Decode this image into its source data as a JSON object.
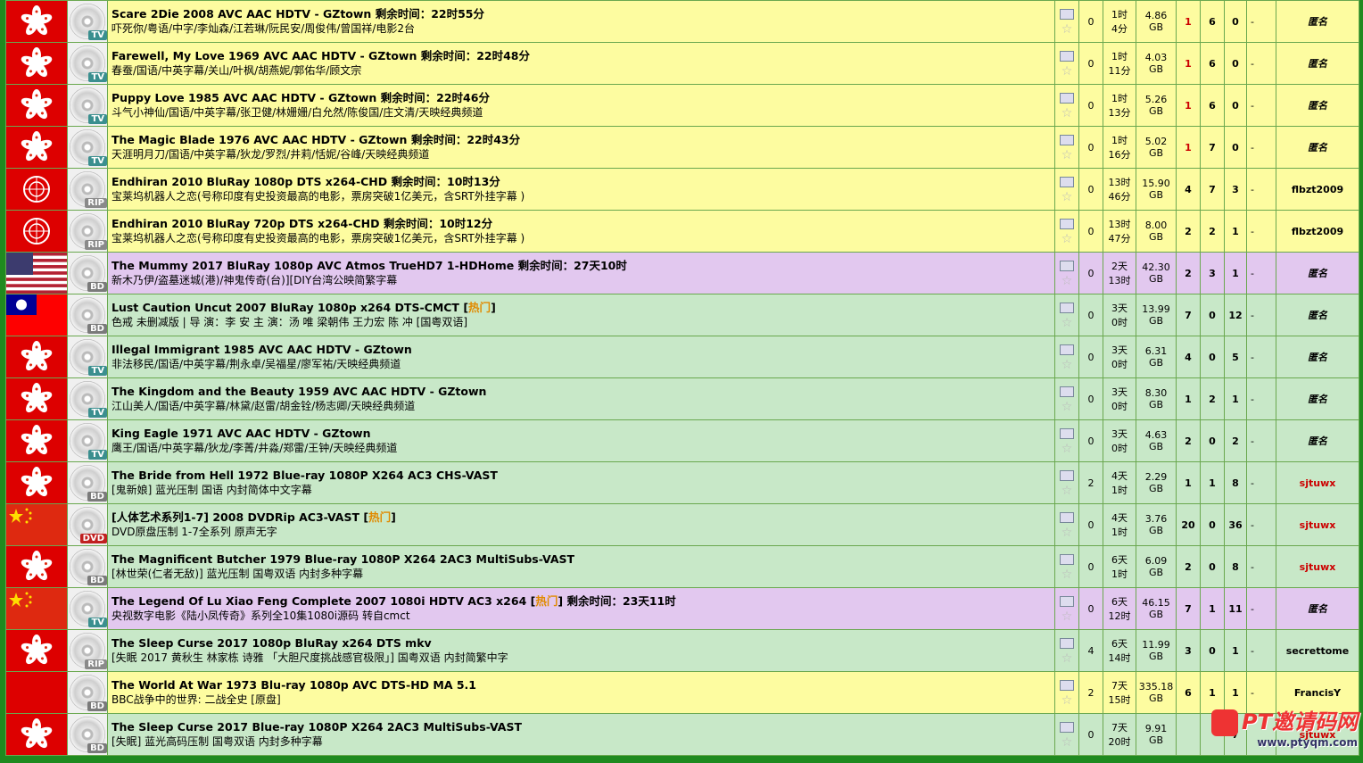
{
  "rows": [
    {
      "bg": "yellow",
      "flag": "hk",
      "cat": "TV",
      "title": "Scare 2Die 2008 AVC AAC HDTV - GZtown",
      "remain": "剩余时间：22时55分",
      "hot": "",
      "sub": "吓死你/粤语/中字/李灿森/江若琳/阮民安/周俊伟/曾国祥/电影2台",
      "comments": "0",
      "time1": "1时",
      "time2": "4分",
      "size1": "4.86",
      "size2": "GB",
      "seeders": "1",
      "seeders_red": true,
      "leechers": "6",
      "snatched": "0",
      "progress": "-",
      "uploader": "匿名",
      "uploader_style": "anon"
    },
    {
      "bg": "yellow",
      "flag": "hk",
      "cat": "TV",
      "title": "Farewell, My Love 1969 AVC AAC HDTV - GZtown",
      "remain": "剩余时间：22时48分",
      "hot": "",
      "sub": "春蚕/国语/中英字幕/关山/叶枫/胡燕妮/郭佑华/顾文宗",
      "comments": "0",
      "time1": "1时",
      "time2": "11分",
      "size1": "4.03",
      "size2": "GB",
      "seeders": "1",
      "seeders_red": true,
      "leechers": "6",
      "snatched": "0",
      "progress": "-",
      "uploader": "匿名",
      "uploader_style": "anon"
    },
    {
      "bg": "yellow",
      "flag": "hk",
      "cat": "TV",
      "title": "Puppy Love 1985 AVC AAC HDTV - GZtown",
      "remain": "剩余时间：22时46分",
      "hot": "",
      "sub": "斗气小神仙/国语/中英字幕/张卫健/林姗姗/白允然/陈俊国/庄文清/天映经典频道",
      "comments": "0",
      "time1": "1时",
      "time2": "13分",
      "size1": "5.26",
      "size2": "GB",
      "seeders": "1",
      "seeders_red": true,
      "leechers": "6",
      "snatched": "0",
      "progress": "-",
      "uploader": "匿名",
      "uploader_style": "anon"
    },
    {
      "bg": "yellow",
      "flag": "hk",
      "cat": "TV",
      "title": "The Magic Blade 1976 AVC AAC HDTV - GZtown",
      "remain": "剩余时间：22时43分",
      "hot": "",
      "sub": "天涯明月刀/国语/中英字幕/狄龙/罗烈/井莉/恬妮/谷峰/天映经典频道",
      "comments": "0",
      "time1": "1时",
      "time2": "16分",
      "size1": "5.02",
      "size2": "GB",
      "seeders": "1",
      "seeders_red": true,
      "leechers": "7",
      "snatched": "0",
      "progress": "-",
      "uploader": "匿名",
      "uploader_style": "anon"
    },
    {
      "bg": "yellow",
      "flag": "un",
      "cat": "RIP",
      "title": "Endhiran 2010 BluRay 1080p DTS x264-CHD",
      "remain": "剩余时间：10时13分",
      "hot": "",
      "sub": "宝莱坞机器人之恋(号称印度有史投资最高的电影，票房突破1亿美元，含SRT外挂字幕 )",
      "comments": "0",
      "time1": "13时",
      "time2": "46分",
      "size1": "15.90",
      "size2": "GB",
      "seeders": "4",
      "seeders_red": false,
      "leechers": "7",
      "snatched": "3",
      "progress": "-",
      "uploader": "flbzt2009",
      "uploader_style": "bold"
    },
    {
      "bg": "yellow",
      "flag": "un",
      "cat": "RIP",
      "title": "Endhiran 2010 BluRay 720p DTS x264-CHD",
      "remain": "剩余时间：10时12分",
      "hot": "",
      "sub": "宝莱坞机器人之恋(号称印度有史投资最高的电影，票房突破1亿美元，含SRT外挂字幕 )",
      "comments": "0",
      "time1": "13时",
      "time2": "47分",
      "size1": "8.00",
      "size2": "GB",
      "seeders": "2",
      "seeders_red": false,
      "leechers": "2",
      "snatched": "1",
      "progress": "-",
      "uploader": "flbzt2009",
      "uploader_style": "bold"
    },
    {
      "bg": "purple",
      "flag": "us",
      "cat": "BD",
      "title": "The Mummy 2017 BluRay 1080p AVC Atmos TrueHD7 1-HDHome",
      "remain": "剩余时间：27天10时",
      "hot": "",
      "sub": "新木乃伊/盗墓迷城(港)/神鬼传奇(台)][DIY台湾公映简繁字幕",
      "comments": "0",
      "time1": "2天",
      "time2": "13时",
      "size1": "42.30",
      "size2": "GB",
      "seeders": "2",
      "seeders_red": false,
      "leechers": "3",
      "snatched": "1",
      "progress": "-",
      "uploader": "匿名",
      "uploader_style": "anon"
    },
    {
      "bg": "green",
      "flag": "tw",
      "cat": "BD",
      "title": "Lust Caution Uncut 2007 BluRay 1080p x264 DTS-CMCT",
      "remain": "",
      "hot": "热门",
      "sub": "色戒 未删减版 | 导 演：李 安 主 演：汤 唯 梁朝伟 王力宏 陈 冲 [国粤双语]",
      "comments": "0",
      "time1": "3天",
      "time2": "0时",
      "size1": "13.99",
      "size2": "GB",
      "seeders": "7",
      "seeders_red": false,
      "leechers": "0",
      "snatched": "12",
      "progress": "-",
      "uploader": "匿名",
      "uploader_style": "anon"
    },
    {
      "bg": "green",
      "flag": "hk",
      "cat": "TV",
      "title": "Illegal Immigrant 1985 AVC AAC HDTV - GZtown",
      "remain": "",
      "hot": "",
      "sub": "非法移民/国语/中英字幕/荆永卓/吴福星/廖军祐/天映经典频道",
      "comments": "0",
      "time1": "3天",
      "time2": "0时",
      "size1": "6.31",
      "size2": "GB",
      "seeders": "4",
      "seeders_red": false,
      "leechers": "0",
      "snatched": "5",
      "progress": "-",
      "uploader": "匿名",
      "uploader_style": "anon"
    },
    {
      "bg": "green",
      "flag": "hk",
      "cat": "TV",
      "title": "The Kingdom and the Beauty 1959 AVC AAC HDTV - GZtown",
      "remain": "",
      "hot": "",
      "sub": "江山美人/国语/中英字幕/林黛/赵雷/胡金铨/杨志卿/天映经典频道",
      "comments": "0",
      "time1": "3天",
      "time2": "0时",
      "size1": "8.30",
      "size2": "GB",
      "seeders": "1",
      "seeders_red": false,
      "leechers": "2",
      "snatched": "1",
      "progress": "-",
      "uploader": "匿名",
      "uploader_style": "anon"
    },
    {
      "bg": "green",
      "flag": "hk",
      "cat": "TV",
      "title": "King Eagle 1971 AVC AAC HDTV - GZtown",
      "remain": "",
      "hot": "",
      "sub": "鹰王/国语/中英字幕/狄龙/李菁/井淼/郑雷/王钟/天映经典频道",
      "comments": "0",
      "time1": "3天",
      "time2": "0时",
      "size1": "4.63",
      "size2": "GB",
      "seeders": "2",
      "seeders_red": false,
      "leechers": "0",
      "snatched": "2",
      "progress": "-",
      "uploader": "匿名",
      "uploader_style": "anon"
    },
    {
      "bg": "green",
      "flag": "hk",
      "cat": "BD",
      "title": "The Bride from Hell 1972 Blue-ray 1080P X264 AC3 CHS-VAST",
      "remain": "",
      "hot": "",
      "sub": "[鬼新娘] 蓝光压制 国语 内封简体中文字幕",
      "comments": "2",
      "time1": "4天",
      "time2": "1时",
      "size1": "2.29",
      "size2": "GB",
      "seeders": "1",
      "seeders_red": false,
      "leechers": "1",
      "snatched": "8",
      "progress": "-",
      "uploader": "sjtuwx",
      "uploader_style": "red"
    },
    {
      "bg": "green",
      "flag": "cn",
      "cat": "DVD",
      "title": "[人体艺术系列1-7] 2008 DVDRip AC3-VAST",
      "remain": "",
      "hot": "热门",
      "sub": "DVD原盘压制 1-7全系列 原声无字",
      "comments": "0",
      "time1": "4天",
      "time2": "1时",
      "size1": "3.76",
      "size2": "GB",
      "seeders": "20",
      "seeders_red": false,
      "leechers": "0",
      "snatched": "36",
      "progress": "-",
      "uploader": "sjtuwx",
      "uploader_style": "red"
    },
    {
      "bg": "green",
      "flag": "hk",
      "cat": "BD",
      "title": "The Magnificent Butcher 1979 Blue-ray 1080P X264 2AC3 MultiSubs-VAST",
      "remain": "",
      "hot": "",
      "sub": "[林世荣(仁者无敌)] 蓝光压制 国粤双语 内封多种字幕",
      "comments": "0",
      "time1": "6天",
      "time2": "1时",
      "size1": "6.09",
      "size2": "GB",
      "seeders": "2",
      "seeders_red": false,
      "leechers": "0",
      "snatched": "8",
      "progress": "-",
      "uploader": "sjtuwx",
      "uploader_style": "red"
    },
    {
      "bg": "purple",
      "flag": "cn",
      "cat": "TV",
      "title": "The Legend Of Lu Xiao Feng Complete 2007 1080i HDTV AC3 x264",
      "remain": "剩余时间：23天11时",
      "hot": "热门",
      "sub": "央视数字电影《陆小凤传奇》系列全10集1080i源码 转自cmct",
      "comments": "0",
      "time1": "6天",
      "time2": "12时",
      "size1": "46.15",
      "size2": "GB",
      "seeders": "7",
      "seeders_red": false,
      "leechers": "1",
      "snatched": "11",
      "progress": "-",
      "uploader": "匿名",
      "uploader_style": "anon"
    },
    {
      "bg": "green",
      "flag": "hk",
      "cat": "RIP",
      "title": "The Sleep Curse 2017 1080p BluRay x264 DTS mkv",
      "remain": "",
      "hot": "",
      "sub": "[失眠 2017 黄秋生 林家栋 诗雅 「大胆尺度挑战感官极限」] 国粤双语 内封简繁中字",
      "comments": "4",
      "time1": "6天",
      "time2": "14时",
      "size1": "11.99",
      "size2": "GB",
      "seeders": "3",
      "seeders_red": false,
      "leechers": "0",
      "snatched": "1",
      "progress": "-",
      "uploader": "secrettome",
      "uploader_style": "bold"
    },
    {
      "bg": "yellow",
      "flag": "photo",
      "cat": "BD",
      "title": "The World At War 1973 Blu-ray 1080p AVC DTS-HD MA 5.1",
      "remain": "",
      "hot": "",
      "sub": "BBC战争中的世界: 二战全史 [原盘]",
      "comments": "2",
      "time1": "7天",
      "time2": "15时",
      "size1": "335.18",
      "size2": "GB",
      "seeders": "6",
      "seeders_red": false,
      "leechers": "1",
      "snatched": "1",
      "progress": "-",
      "uploader": "FrancisY",
      "uploader_style": "bold"
    },
    {
      "bg": "green",
      "flag": "hk",
      "cat": "BD",
      "title": "The Sleep Curse 2017 Blue-ray 1080P X264 2AC3 MultiSubs-VAST",
      "remain": "",
      "hot": "",
      "sub": "[失眠] 蓝光高码压制 国粤双语 内封多种字幕",
      "comments": "0",
      "time1": "7天",
      "time2": "20时",
      "size1": "9.91",
      "size2": "GB",
      "seeders": "",
      "seeders_red": false,
      "leechers": "",
      "snatched": "7",
      "progress": "",
      "uploader": "sjtuwx",
      "uploader_style": "red"
    }
  ],
  "watermark": {
    "text": "PT邀请码网",
    "url": "www.ptyqm.com"
  },
  "icons": {
    "download": "download-icon",
    "bookmark": "star-icon",
    "disc": "disc-icon"
  }
}
